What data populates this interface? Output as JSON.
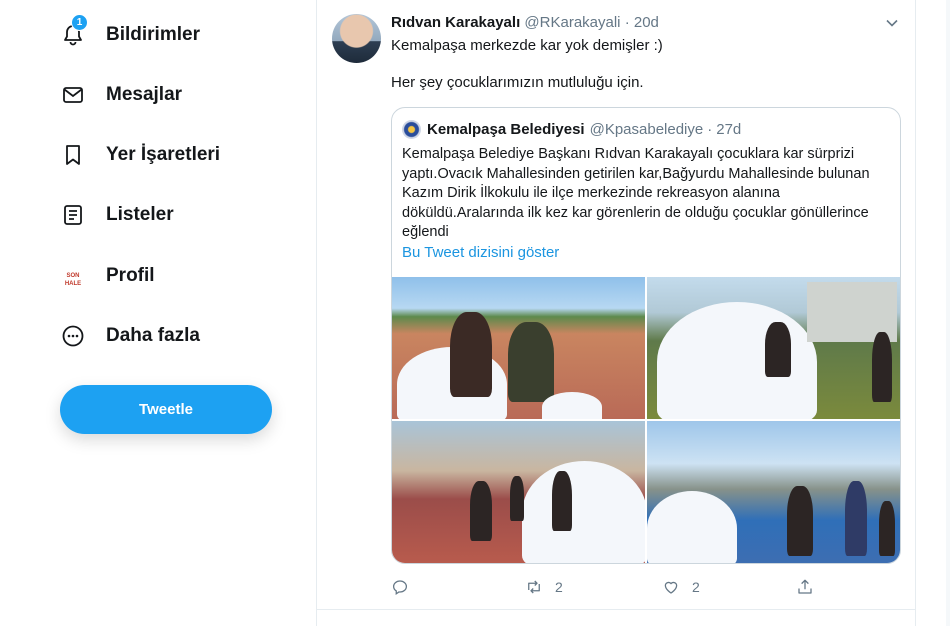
{
  "sidebar": {
    "notifications": {
      "label": "Bildirimler",
      "badge": "1",
      "icon": "bell-icon"
    },
    "messages": {
      "label": "Mesajlar",
      "icon": "mail-icon"
    },
    "bookmarks": {
      "label": "Yer İşaretleri",
      "icon": "bookmark-icon"
    },
    "lists": {
      "label": "Listeler",
      "icon": "list-icon"
    },
    "profile": {
      "label": "Profil",
      "icon": "profile-avatar"
    },
    "more": {
      "label": "Daha fazla",
      "icon": "more-circle-icon"
    },
    "tweet_button": "Tweetle"
  },
  "tweet": {
    "author_name": "Rıdvan Karakayalı",
    "author_handle": "@RKarakayali",
    "separator": "·",
    "time": "20d",
    "text_line1": "Kemalpaşa merkezde kar yok demişler :)",
    "text_line2": "Her şey çocuklarımızın mutluluğu için.",
    "quoted": {
      "author_name": "Kemalpaşa Belediyesi",
      "author_handle": "@Kpasabelediye",
      "separator": "·",
      "time": "27d",
      "text": "Kemalpaşa Belediye Başkanı Rıdvan Karakayalı çocuklara kar sürprizi yaptı.Ovacık Mahallesinden getirilen kar,Bağyurdu Mahallesinde bulunan Kazım Dirik İlkokulu ile ilçe merkezinde rekreasyon alanına döküldü.Aralarında ilk kez kar görenlerin de olduğu çocuklar gönüllerince eğlendi",
      "show_thread": "Bu Tweet dizisini göster"
    },
    "actions": {
      "reply_count": "",
      "retweet_count": "2",
      "like_count": "2"
    }
  },
  "colors": {
    "accent": "#1da1f2",
    "link": "#1b95e0",
    "muted": "#657786"
  }
}
